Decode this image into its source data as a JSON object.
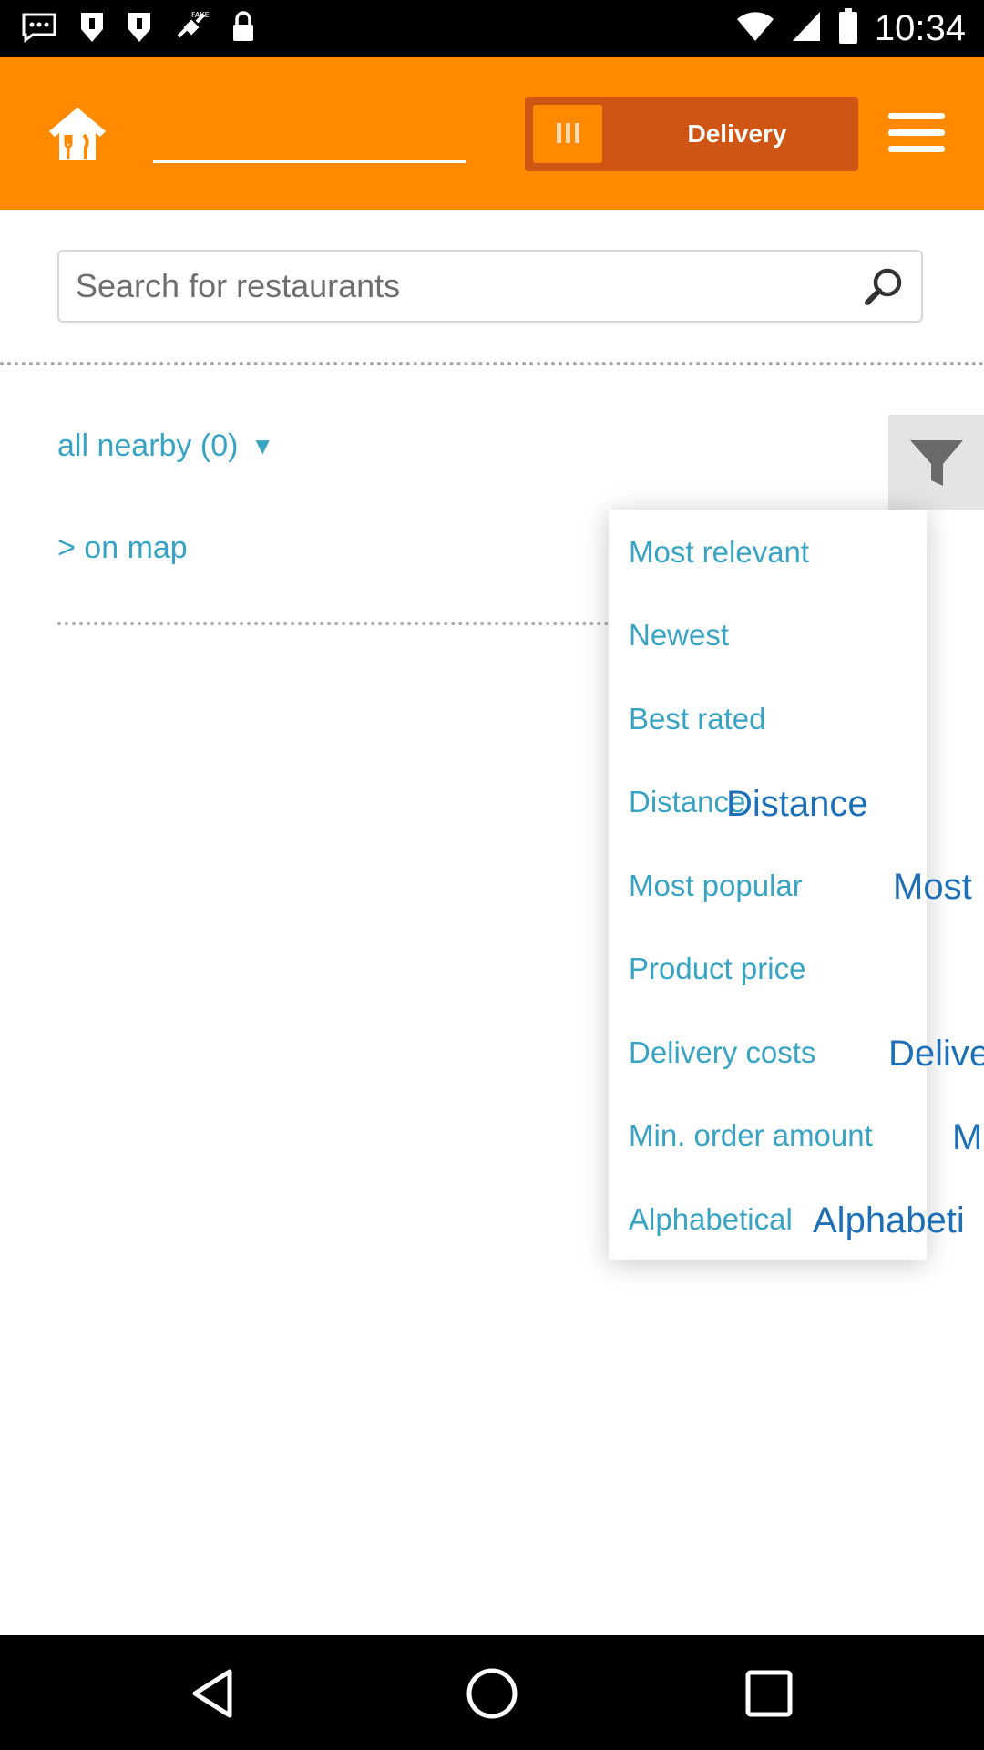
{
  "status_bar": {
    "time": "10:34",
    "icons": [
      "message-icon",
      "notification-icon",
      "notification-icon",
      "fake-gps-icon",
      "lock-icon",
      "wifi-icon",
      "signal-icon",
      "battery-icon"
    ]
  },
  "app_bar": {
    "home_icon": "restaurant-home-icon",
    "address_value": "",
    "mode_toggle": {
      "icon": "grid-icon",
      "label": "Delivery"
    },
    "menu_icon": "hamburger-icon",
    "colors": {
      "bar": "#ff8a00",
      "toggle": "#cf5514"
    }
  },
  "search": {
    "placeholder": "Search for restaurants",
    "icon": "search-icon"
  },
  "filter": {
    "nearby_label": "all nearby (0)",
    "nearby_arrow": "▼",
    "map_link": "> on map",
    "filter_icon": "funnel-icon",
    "link_color": "#39a3c4"
  },
  "sort_menu": {
    "items": [
      "Most relevant",
      "Newest",
      "Best rated",
      "Distance",
      "Most popular",
      "Product price",
      "Delivery costs",
      "Min. order amount",
      "Alphabetical"
    ],
    "overlay_labels": [
      "Distance",
      "Most",
      "Delive",
      "M",
      "Alphabeti"
    ]
  },
  "nav_bar": {
    "back_icon": "back-icon",
    "home_icon": "home-circle-icon",
    "recents_icon": "recents-icon"
  }
}
